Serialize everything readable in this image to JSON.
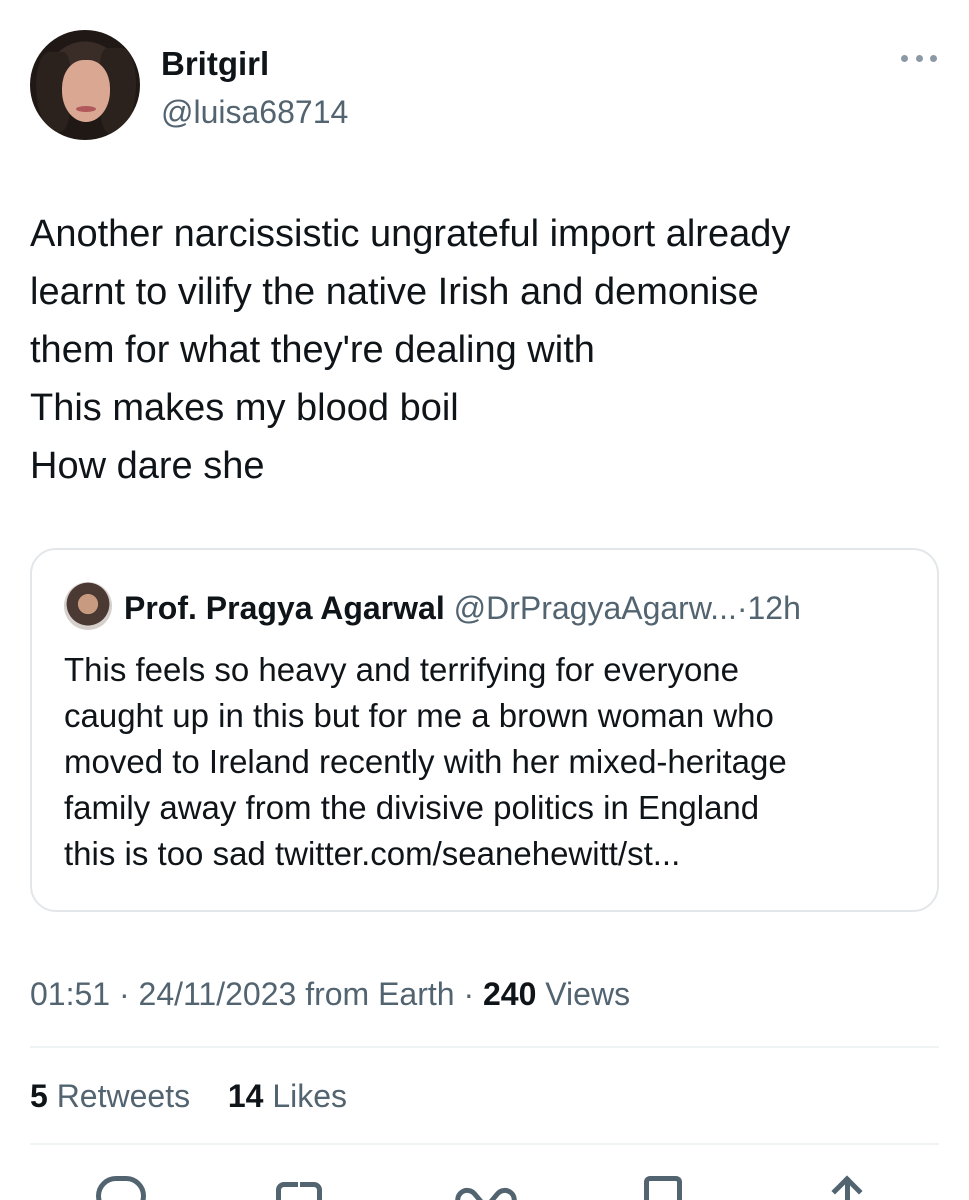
{
  "author": {
    "display_name": "Britgirl",
    "handle": "@luisa68714",
    "avatar_icon": "profile-photo"
  },
  "more_icon": "more-horizontal-icon",
  "tweet": {
    "lines": [
      "Another narcissistic ungrateful import already",
      "learnt to vilify the native Irish and demonise",
      "them for what they're dealing with",
      "This makes my blood boil",
      "How dare she"
    ]
  },
  "quoted_tweet": {
    "display_name": "Prof. Pragya Agarwal",
    "handle": "@DrPragyaAgarw...",
    "separator": "·",
    "time": "12h",
    "lines": [
      "This feels so heavy and terrifying for everyone",
      "caught up in this but for me a brown woman who",
      "moved to Ireland recently with her mixed-heritage",
      "family away from the divisive politics in England",
      "this is too sad twitter.com/seanehewitt/st..."
    ]
  },
  "meta": {
    "time": "01:51",
    "separator": "·",
    "date": "24/11/2023",
    "source": "from Earth",
    "separator2": "·",
    "views_count": "240",
    "views_label": "Views"
  },
  "stats": {
    "retweets_count": "5",
    "retweets_label": "Retweets",
    "likes_count": "14",
    "likes_label": "Likes"
  },
  "actions": [
    "reply-icon",
    "retweet-icon",
    "like-icon",
    "bookmark-icon",
    "share-icon"
  ],
  "colors": {
    "text_primary": "#0f1419",
    "text_secondary": "#536471",
    "border": "#e3e7ea",
    "background": "#ffffff"
  }
}
